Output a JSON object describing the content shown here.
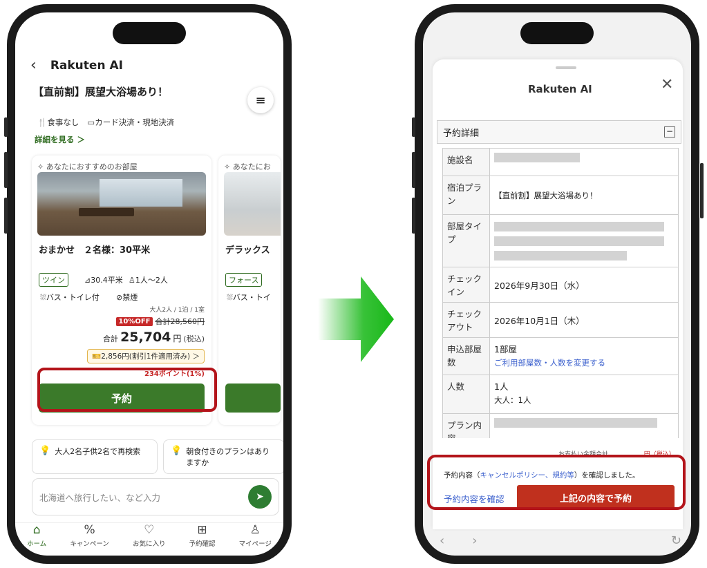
{
  "left": {
    "app_title": "Rakuten AI",
    "plan_title": "【直前割】展望大浴場あり！",
    "plan_tags": [
      "食事なし",
      "カード決済・現地決済"
    ],
    "details_link": "詳細を見る ＞",
    "cards": [
      {
        "recommend_label": "あなたにおすすめのお部屋",
        "name": "おまかせ　２名様：30平米",
        "room_type": "ツイン",
        "size": "30.4平米",
        "guests": "1人〜2人",
        "bath": "バス・トイレ付",
        "smoking": "禁煙",
        "per": "大人2人 / 1泊 / 1室",
        "discount_badge": "10%OFF",
        "original_price": "合計28,560円",
        "total_label": "合計",
        "total_value": "25,704",
        "total_unit": "円",
        "total_tax": "(税込)",
        "coupon": "2,856円(割引1件適用済み) ＞",
        "points": "234ポイント(1%)",
        "reserve_label": "予約"
      },
      {
        "recommend_label": "あなたにお",
        "name": "デラックス",
        "room_type": "フォース",
        "bath": "バス・トイ"
      }
    ],
    "suggestions": [
      "大人2名子供2名で再検索",
      "朝食付きのプランはありますか"
    ],
    "chat_placeholder": "北海道へ旅行したい、など入力",
    "nav": [
      {
        "label": "ホーム",
        "icon": "home-icon"
      },
      {
        "label": "キャンペーン",
        "icon": "percent-badge-icon"
      },
      {
        "label": "お気に入り",
        "icon": "heart-icon"
      },
      {
        "label": "予約確認",
        "icon": "luggage-icon"
      },
      {
        "label": "マイページ",
        "icon": "person-icon"
      }
    ]
  },
  "right": {
    "app_title": "Rakuten AI",
    "section_title": "予約詳細",
    "rows": {
      "facility_label": "施設名",
      "plan_label": "宿泊プラン",
      "plan_value": "【直前割】展望大浴場あり！",
      "room_type_label": "部屋タイプ",
      "checkin_label": "チェックイン",
      "checkin_value": "2026年9月30日（水）",
      "checkout_label": "チェックアウト",
      "checkout_value": "2026年10月1日（木）",
      "rooms_label": "申込部屋数",
      "rooms_value": "1部屋",
      "rooms_link": "ご利用部屋数・人数を変更する",
      "people_label": "人数",
      "people_value": "1人",
      "people_detail": "大人：1人",
      "plan_content_label": "プラン内容"
    },
    "payment_label": "お支払い金額合計",
    "payment_unit": "円（税込）",
    "confirm_prefix": "予約内容（",
    "confirm_link": "キャンセルポリシー、規約等",
    "confirm_suffix": "）を確認しました。",
    "check_link": "予約内容を確認",
    "final_button": "上記の内容で予約"
  },
  "colors": {
    "green": "#3b7a2a",
    "red_highlight": "#b3141a",
    "cta_red": "#c0301e",
    "link_blue": "#3a5fcd"
  }
}
